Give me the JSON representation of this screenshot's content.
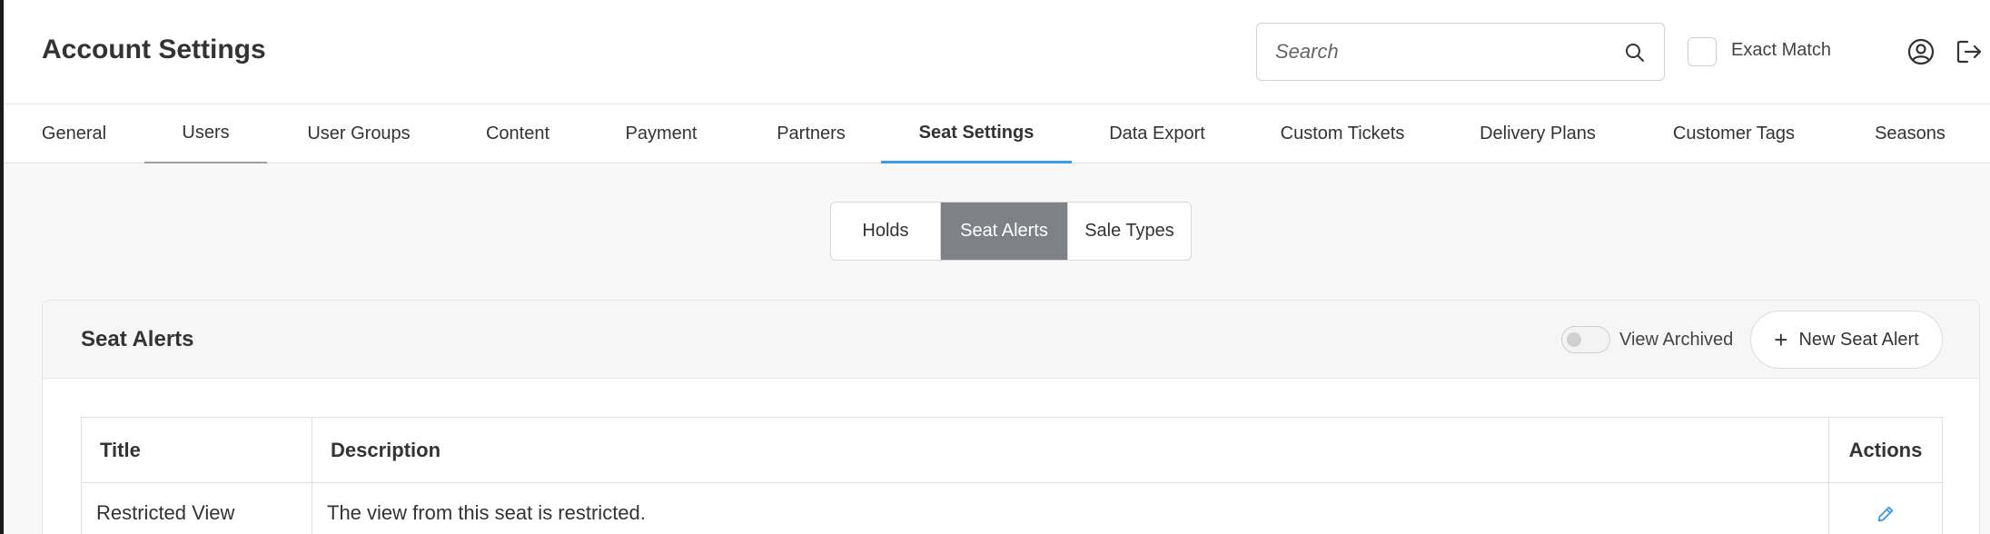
{
  "header": {
    "title": "Account Settings",
    "search": {
      "placeholder": "Search",
      "value": ""
    },
    "exact_match_label": "Exact Match",
    "exact_match_checked": false
  },
  "tabs": [
    {
      "label": "General"
    },
    {
      "label": "Users"
    },
    {
      "label": "User Groups"
    },
    {
      "label": "Content"
    },
    {
      "label": "Payment"
    },
    {
      "label": "Partners"
    },
    {
      "label": "Seat Settings",
      "active": true
    },
    {
      "label": "Data Export"
    },
    {
      "label": "Custom Tickets"
    },
    {
      "label": "Delivery Plans"
    },
    {
      "label": "Customer Tags"
    },
    {
      "label": "Seasons"
    }
  ],
  "subtabs": [
    {
      "label": "Holds"
    },
    {
      "label": "Seat Alerts",
      "active": true
    },
    {
      "label": "Sale Types"
    }
  ],
  "panel": {
    "title": "Seat Alerts",
    "view_archived_label": "View Archived",
    "view_archived_on": false,
    "new_button_label": "New Seat Alert"
  },
  "table": {
    "columns": [
      "Title",
      "Description",
      "Actions"
    ],
    "rows": [
      {
        "title": "Restricted View",
        "description": "The view from this seat is restricted."
      }
    ]
  },
  "icons": {
    "search": "search-icon",
    "user": "user-circle-icon",
    "logout": "logout-icon",
    "plus": "plus-icon",
    "edit": "pencil-icon"
  },
  "colors": {
    "accent": "#3d9be9",
    "segment_active": "#7e8185",
    "content_bg": "#f8f8f8"
  }
}
